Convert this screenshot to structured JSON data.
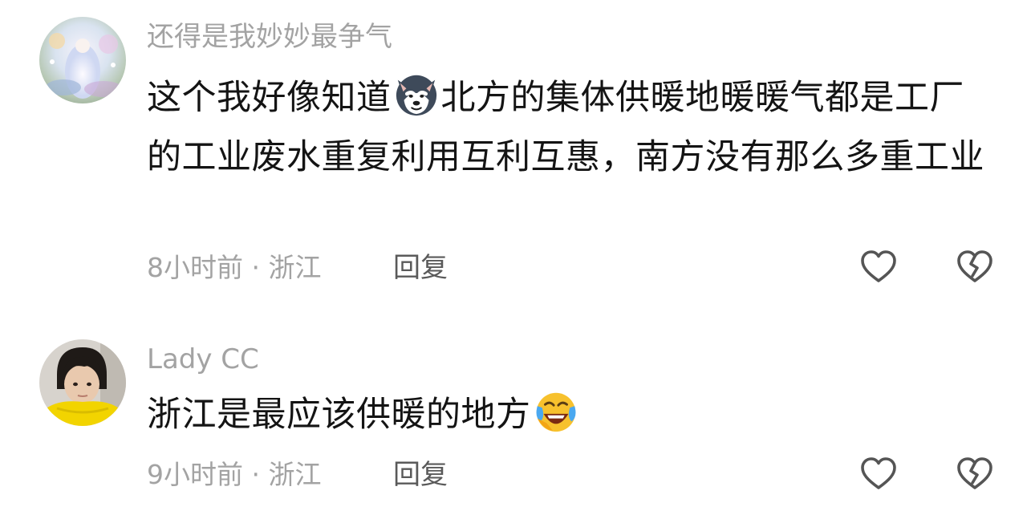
{
  "comments": [
    {
      "username": "还得是我妙妙最争气",
      "text_before_emoji": "这个我好像知道",
      "emoji": "husky-face-icon",
      "text_after_emoji": "北方的集体供暖地暖暖气都是工厂的工业废水重复利用互利互惠，南方没有那么多重工业",
      "time_location": "8小时前 · 浙江",
      "reply_label": "回复"
    },
    {
      "username": "Lady  CC",
      "text_before_emoji": "浙江是最应该供暖的地方",
      "emoji": "laughing-crying-face-icon",
      "time_location": "9小时前 · 浙江",
      "reply_label": "回复"
    }
  ],
  "colors": {
    "text": "#141414",
    "muted": "#a3a3a3",
    "reply": "#5a5a5a",
    "icon": "#555555"
  }
}
